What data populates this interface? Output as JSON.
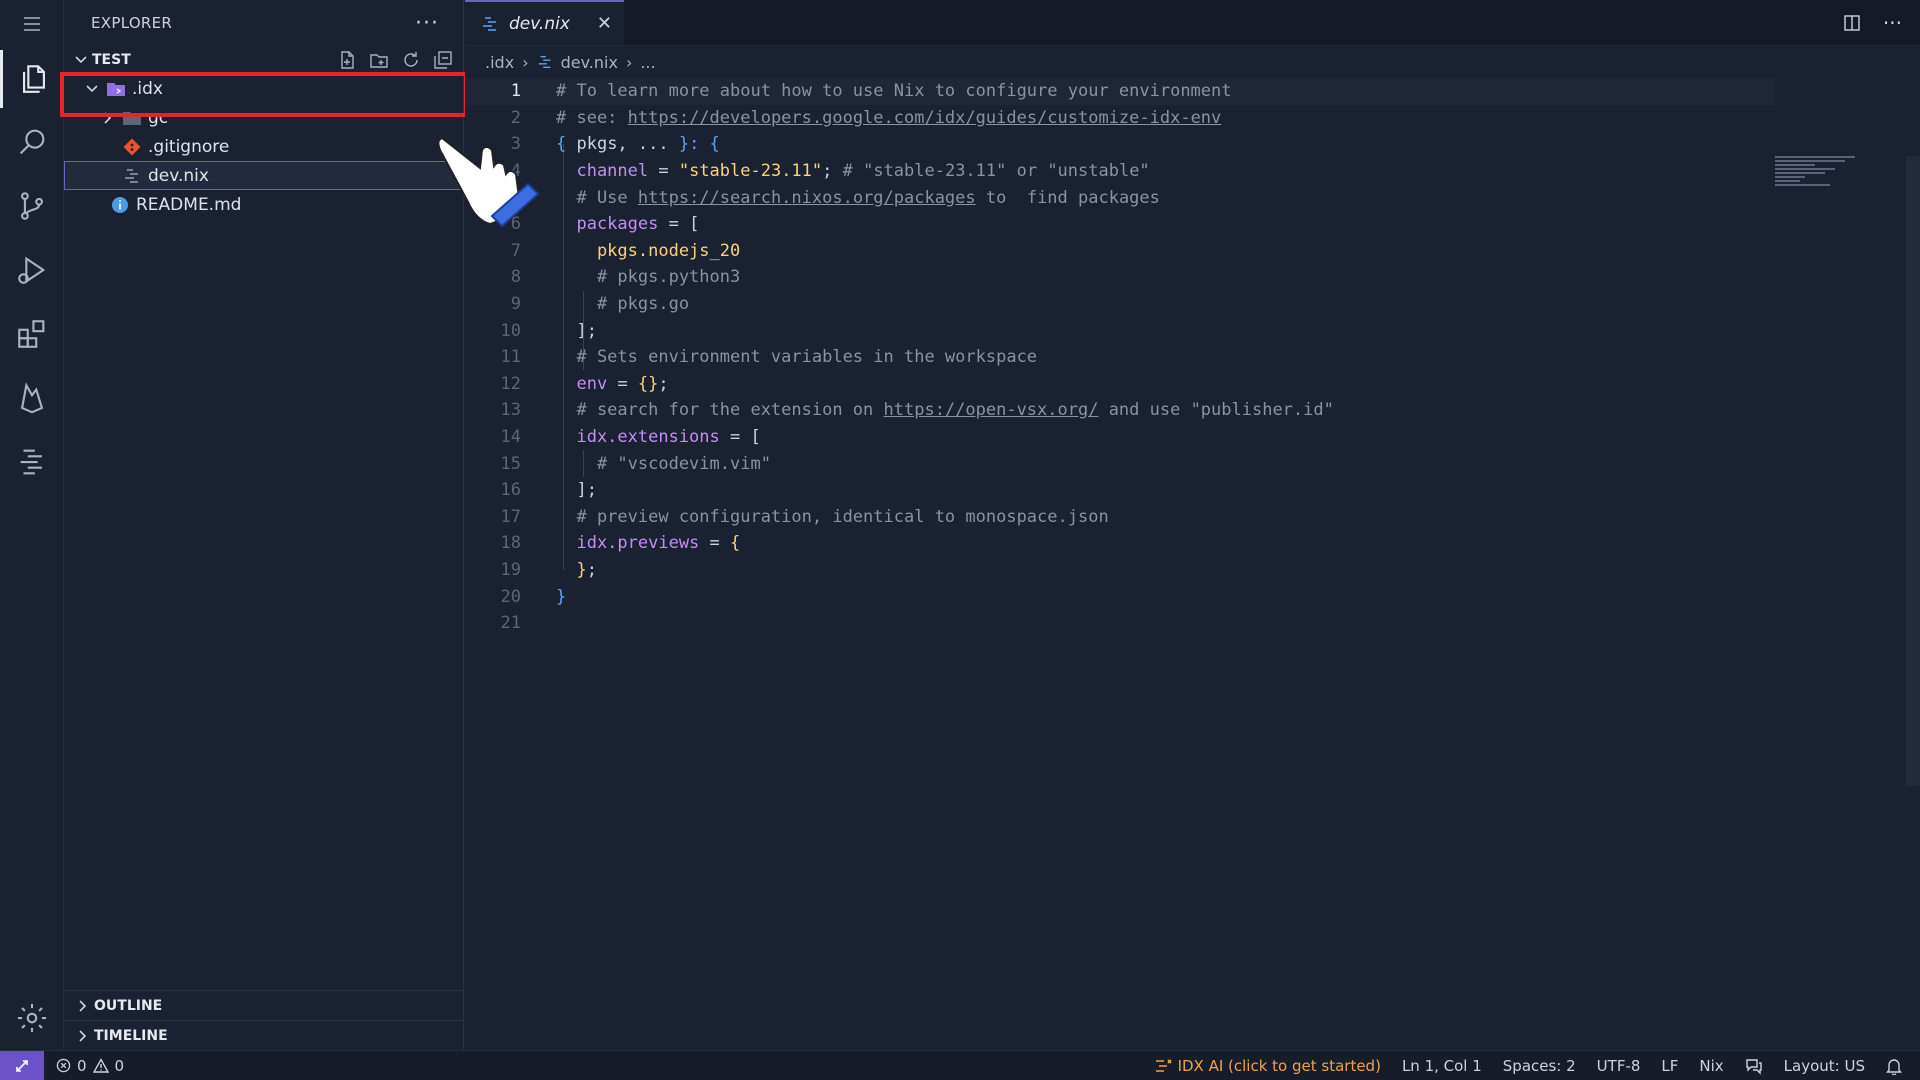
{
  "activity": {
    "items": [
      "menu-icon",
      "files-icon",
      "search-icon",
      "source-control-icon",
      "run-debug-icon",
      "extensions-icon",
      "firebase-icon",
      "outline-list-icon",
      "settings-gear-icon"
    ]
  },
  "sidebar": {
    "title": "EXPLORER",
    "more": "···",
    "section": "TEST",
    "tree": [
      {
        "label": ".idx",
        "type": "folder-open"
      },
      {
        "label": "gc",
        "type": "folder"
      },
      {
        "label": ".gitignore",
        "type": "git"
      },
      {
        "label": "dev.nix",
        "type": "nix"
      },
      {
        "label": "README.md",
        "type": "info"
      }
    ],
    "outline": "OUTLINE",
    "timeline": "TIMELINE"
  },
  "editor": {
    "tab_label": "dev.nix",
    "tab_close": "✕",
    "breadcrumbs": [
      ".idx",
      "dev.nix",
      "..."
    ],
    "lines": [
      {
        "n": "1",
        "segments": [
          {
            "t": "# To learn more about how to use Nix to configure your environment",
            "c": "c-com"
          }
        ]
      },
      {
        "n": "2",
        "segments": [
          {
            "t": "# see: ",
            "c": "c-com"
          },
          {
            "t": "https://developers.google.com/idx/guides/customize-idx-env",
            "c": "c-link"
          }
        ]
      },
      {
        "n": "3",
        "segments": [
          {
            "t": "{ ",
            "c": "c-brace"
          },
          {
            "t": "pkgs, ... ",
            "c": "c-op"
          },
          {
            "t": "}: {",
            "c": "c-brace"
          }
        ]
      },
      {
        "n": "4",
        "segments": [
          {
            "t": "  channel ",
            "c": "c-key"
          },
          {
            "t": "= ",
            "c": "c-op"
          },
          {
            "t": "\"stable-23.11\"",
            "c": "c-str"
          },
          {
            "t": "; ",
            "c": "c-op"
          },
          {
            "t": "# \"stable-23.11\" or \"unstable\"",
            "c": "c-com"
          }
        ]
      },
      {
        "n": "5",
        "segments": [
          {
            "t": "  # Use ",
            "c": "c-com"
          },
          {
            "t": "https://search.nixos.org/packages",
            "c": "c-link"
          },
          {
            "t": " to  find packages",
            "c": "c-com"
          }
        ]
      },
      {
        "n": "6",
        "segments": [
          {
            "t": "  packages ",
            "c": "c-key"
          },
          {
            "t": "= [",
            "c": "c-op"
          }
        ]
      },
      {
        "n": "7",
        "segments": [
          {
            "t": "    pkgs.nodejs_20",
            "c": "c-pkg"
          }
        ]
      },
      {
        "n": "8",
        "segments": [
          {
            "t": "    # pkgs.python3",
            "c": "c-com"
          }
        ]
      },
      {
        "n": "9",
        "segments": [
          {
            "t": "    # pkgs.go",
            "c": "c-com"
          }
        ]
      },
      {
        "n": "10",
        "segments": [
          {
            "t": "  ];",
            "c": "c-op"
          }
        ]
      },
      {
        "n": "11",
        "segments": [
          {
            "t": "  # Sets environment variables in the workspace",
            "c": "c-com"
          }
        ]
      },
      {
        "n": "12",
        "segments": [
          {
            "t": "  env ",
            "c": "c-key"
          },
          {
            "t": "= ",
            "c": "c-op"
          },
          {
            "t": "{}",
            "c": "c-str"
          },
          {
            "t": ";",
            "c": "c-op"
          }
        ]
      },
      {
        "n": "13",
        "segments": [
          {
            "t": "  # search for the extension on ",
            "c": "c-com"
          },
          {
            "t": "https://open-vsx.org/",
            "c": "c-link"
          },
          {
            "t": " and use \"publisher.id\"",
            "c": "c-com"
          }
        ]
      },
      {
        "n": "14",
        "segments": [
          {
            "t": "  idx.extensions ",
            "c": "c-key"
          },
          {
            "t": "= [",
            "c": "c-op"
          }
        ]
      },
      {
        "n": "15",
        "segments": [
          {
            "t": "    # \"vscodevim.vim\"",
            "c": "c-com"
          }
        ]
      },
      {
        "n": "16",
        "segments": [
          {
            "t": "  ];",
            "c": "c-op"
          }
        ]
      },
      {
        "n": "17",
        "segments": [
          {
            "t": "  # preview configuration, identical to monospace.json",
            "c": "c-com"
          }
        ]
      },
      {
        "n": "18",
        "segments": [
          {
            "t": "  idx.previews ",
            "c": "c-key"
          },
          {
            "t": "= ",
            "c": "c-op"
          },
          {
            "t": "{",
            "c": "c-str"
          }
        ]
      },
      {
        "n": "19",
        "segments": [
          {
            "t": "  ",
            "c": "c-op"
          },
          {
            "t": "}",
            "c": "c-str"
          },
          {
            "t": ";",
            "c": "c-op"
          }
        ]
      },
      {
        "n": "20",
        "segments": [
          {
            "t": "}",
            "c": "c-brace"
          }
        ]
      },
      {
        "n": "21",
        "segments": []
      }
    ]
  },
  "status": {
    "errors": "0",
    "warnings": "0",
    "ai": "IDX AI (click to get started)",
    "position": "Ln 1, Col 1",
    "spaces": "Spaces: 2",
    "encoding": "UTF-8",
    "eol": "LF",
    "language": "Nix",
    "layout": "Layout: US"
  },
  "colors": {
    "accent": "#6c52c9",
    "highlight": "#e8242b",
    "ai": "#f0a24b"
  }
}
